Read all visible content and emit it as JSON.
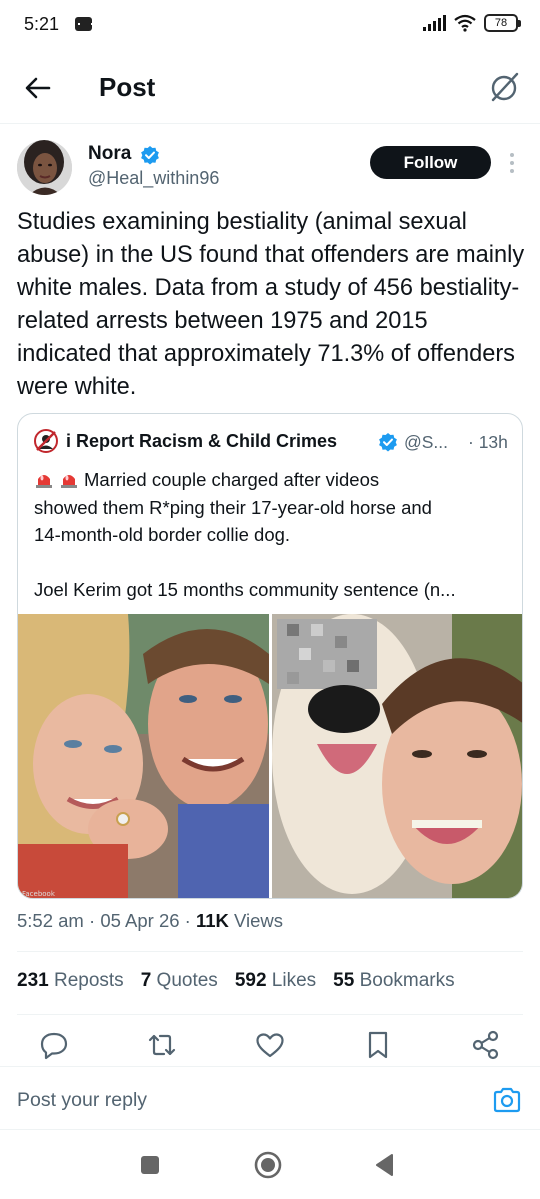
{
  "status_bar": {
    "time": "5:21",
    "battery": "78"
  },
  "header": {
    "title": "Post"
  },
  "author": {
    "name": "Nora",
    "handle": "@Heal_within96",
    "follow_label": "Follow"
  },
  "post": {
    "text": "Studies examining bestiality (animal sexual abuse) in the US found that offenders are mainly white males. Data from a study of 456 bestiality-related arrests between 1975 and 2015 indicated that approximately 71.3% of offenders were white."
  },
  "quote": {
    "name": "i Report Racism & Child Crimes",
    "handle": "@S...",
    "time": "· 13h",
    "line1": "Married couple charged after videos",
    "line2": "showed them R*ping their 17-year-old horse and",
    "line3": "14-month-old border collie dog.",
    "line4": "Joel Kerim got 15 months community sentence (n...",
    "image_watermark": "Facebook"
  },
  "meta": {
    "time": "5:52 am",
    "date": "05 Apr 26",
    "views_count": "11K",
    "views_label": "Views"
  },
  "stats": {
    "reposts_count": "231",
    "reposts_label": "Reposts",
    "quotes_count": "7",
    "quotes_label": "Quotes",
    "likes_count": "592",
    "likes_label": "Likes",
    "bookmarks_count": "55",
    "bookmarks_label": "Bookmarks"
  },
  "reply": {
    "placeholder": "Post your reply"
  },
  "colors": {
    "text": "#0f1419",
    "secondary": "#536471",
    "accent": "#1d9bf0",
    "border": "#cfd9de"
  },
  "icons": {
    "back": "arrow-left-icon",
    "grok": "grok-icon",
    "verified": "verified-badge-icon",
    "more": "more-vertical-icon",
    "reply": "reply-icon",
    "repost": "repost-icon",
    "like": "heart-icon",
    "bookmark": "bookmark-icon",
    "share": "share-icon",
    "camera": "camera-icon",
    "siren": "siren-emoji-icon"
  }
}
